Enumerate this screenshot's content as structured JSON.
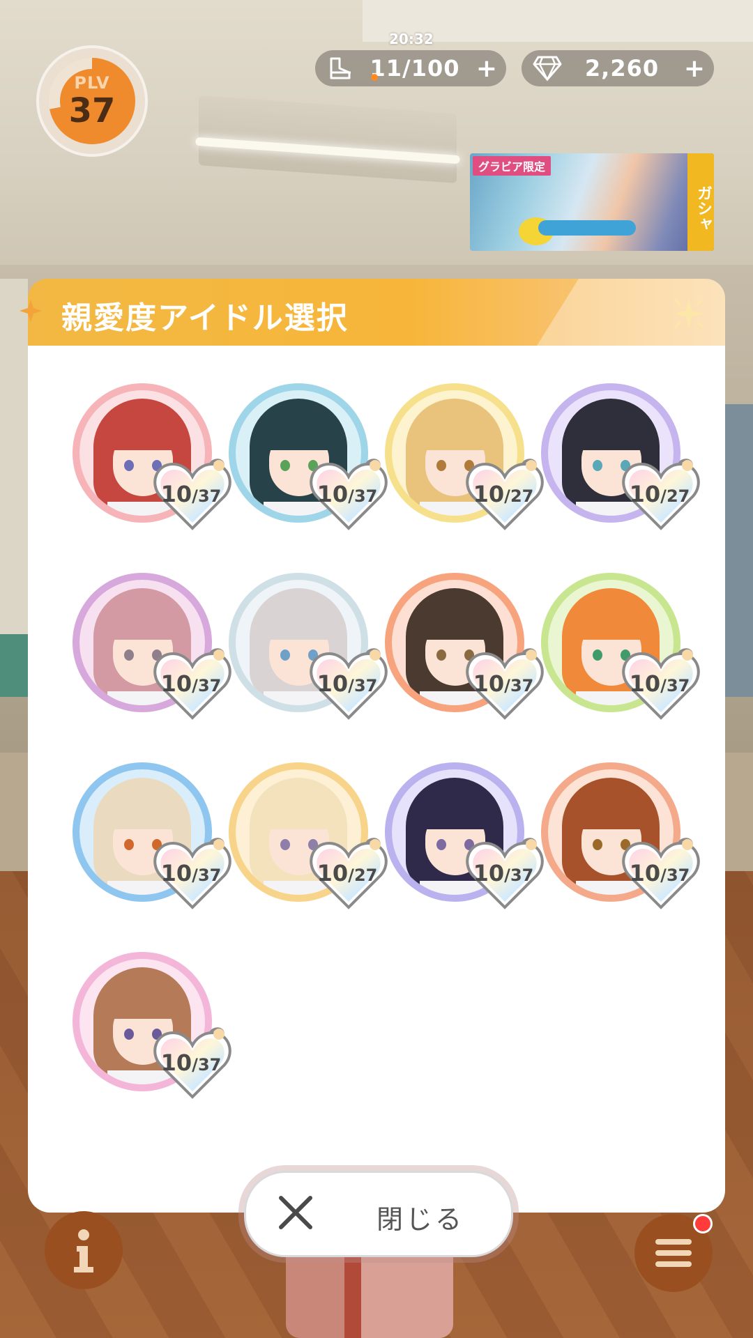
{
  "hud": {
    "player_level_label": "PLV",
    "player_level": "37",
    "stamina_timer": "20:32",
    "stamina": "11/100",
    "gems": "2,260",
    "plus": "+"
  },
  "banner": {
    "tag": "グラビア限定",
    "side_label": "ガシャ"
  },
  "dialog": {
    "title": "親愛度アイドル選択",
    "close_label": "閉じる"
  },
  "idols": [
    {
      "level": "10",
      "max": "37",
      "ring": "#f6b3b8",
      "bg": "#fbe1e3",
      "hair": "#c6473f",
      "eye": "#6d6fb6"
    },
    {
      "level": "10",
      "max": "37",
      "ring": "#9fd5e8",
      "bg": "#d9f0f6",
      "hair": "#274349",
      "eye": "#5aa15a"
    },
    {
      "level": "10",
      "max": "27",
      "ring": "#f7e08c",
      "bg": "#fdf3cf",
      "hair": "#e9c27b",
      "eye": "#b07b3a"
    },
    {
      "level": "10",
      "max": "27",
      "ring": "#c5b4ee",
      "bg": "#ebe3fb",
      "hair": "#2e2f3a",
      "eye": "#5aa7b8"
    },
    {
      "level": "10",
      "max": "37",
      "ring": "#d7a8dc",
      "bg": "#f7e0ef",
      "hair": "#d39aa3",
      "eye": "#8f7f8a"
    },
    {
      "level": "10",
      "max": "37",
      "ring": "#cfdfe6",
      "bg": "#eef4f7",
      "hair": "#d9d3d4",
      "eye": "#6ea0c8"
    },
    {
      "level": "10",
      "max": "37",
      "ring": "#f7a47e",
      "bg": "#fde0d3",
      "hair": "#4b3a30",
      "eye": "#8a6a40"
    },
    {
      "level": "10",
      "max": "37",
      "ring": "#c8e58f",
      "bg": "#eaf6d2",
      "hair": "#f08a3a",
      "eye": "#3f9c6a"
    },
    {
      "level": "10",
      "max": "37",
      "ring": "#8ec6ef",
      "bg": "#d9edfb",
      "hair": "#eadbc0",
      "eye": "#d0682b"
    },
    {
      "level": "10",
      "max": "27",
      "ring": "#f8d48a",
      "bg": "#fdf0d4",
      "hair": "#f3e2bb",
      "eye": "#8d7fa8"
    },
    {
      "level": "10",
      "max": "37",
      "ring": "#b9b2ee",
      "bg": "#e6e2fb",
      "hair": "#2f2a4a",
      "eye": "#7d6aa0"
    },
    {
      "level": "10",
      "max": "37",
      "ring": "#f4a98a",
      "bg": "#fde3d6",
      "hair": "#a8522b",
      "eye": "#9b6a2a"
    },
    {
      "level": "10",
      "max": "37",
      "ring": "#f3b5d8",
      "bg": "#fde4f1",
      "hair": "#b57a57",
      "eye": "#6a5a9a"
    }
  ]
}
